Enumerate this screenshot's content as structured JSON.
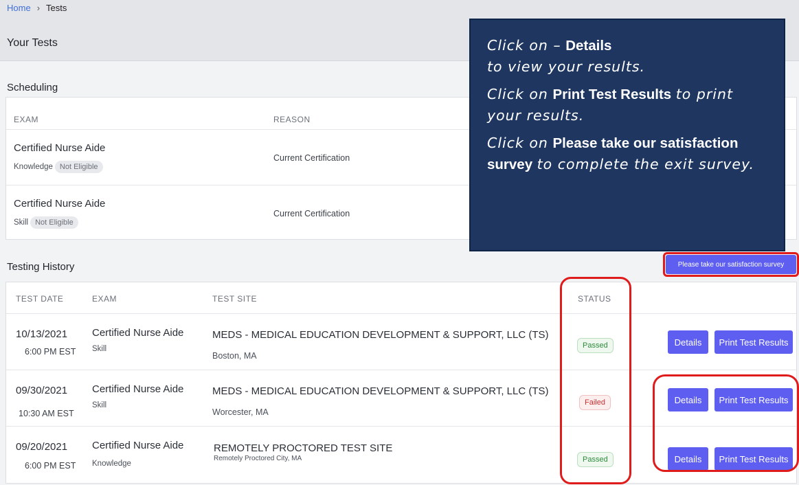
{
  "breadcrumb": {
    "home": "Home",
    "separator": "›",
    "current": "Tests"
  },
  "page_title": "Your Tests",
  "scheduling": {
    "title": "Scheduling",
    "headers": {
      "exam": "EXAM",
      "reason": "REASON"
    },
    "rows": [
      {
        "exam": "Certified Nurse Aide",
        "type": "Knowledge",
        "eligibility": "Not Eligible",
        "reason": "Current Certification"
      },
      {
        "exam": "Certified Nurse Aide",
        "type": "Skill",
        "eligibility": "Not Eligible",
        "reason": "Current Certification"
      }
    ]
  },
  "history": {
    "title": "Testing History",
    "survey_button": "Please take our satisfaction survey",
    "headers": {
      "date": "TEST DATE",
      "exam": "EXAM",
      "site": "TEST SITE",
      "status": "STATUS"
    },
    "rows": [
      {
        "date": "10/13/2021",
        "time": "6:00 PM EST",
        "exam": "Certified Nurse Aide",
        "type": "Skill",
        "site": "MEDS - MEDICAL EDUCATION DEVELOPMENT & SUPPORT, LLC (TS)",
        "location": "Boston, MA",
        "status": "Passed",
        "details": "Details",
        "print": "Print Test Results"
      },
      {
        "date": "09/30/2021",
        "time": "10:30 AM EST",
        "exam": "Certified Nurse Aide",
        "type": "Skill",
        "site": "MEDS - MEDICAL EDUCATION DEVELOPMENT & SUPPORT, LLC (TS)",
        "location": "Worcester, MA",
        "status": "Failed",
        "details": "Details",
        "print": "Print Test Results"
      },
      {
        "date": "09/20/2021",
        "time": "6:00 PM EST",
        "exam": "Certified Nurse Aide",
        "type": "Knowledge",
        "site": "REMOTELY PROCTORED TEST SITE",
        "location": "Remotely Proctored City, MA",
        "status": "Passed",
        "details": "Details",
        "print": "Print Test Results"
      }
    ]
  },
  "callout": {
    "l1_a": "Click on –",
    "l1_b": "Details",
    "l1_c": "to view your results.",
    "l2_a": "Click on",
    "l2_b": "Print Test Results",
    "l2_c": "to print your results.",
    "l3_a": "Click on",
    "l3_b": "Please take our satisfaction survey",
    "l3_c": "to complete the exit survey."
  },
  "colors": {
    "accent": "#5e5ef0",
    "callout_bg": "#1e3660",
    "annotation": "#e01b1b",
    "passed": "#2f8a3d",
    "failed": "#c93030"
  }
}
